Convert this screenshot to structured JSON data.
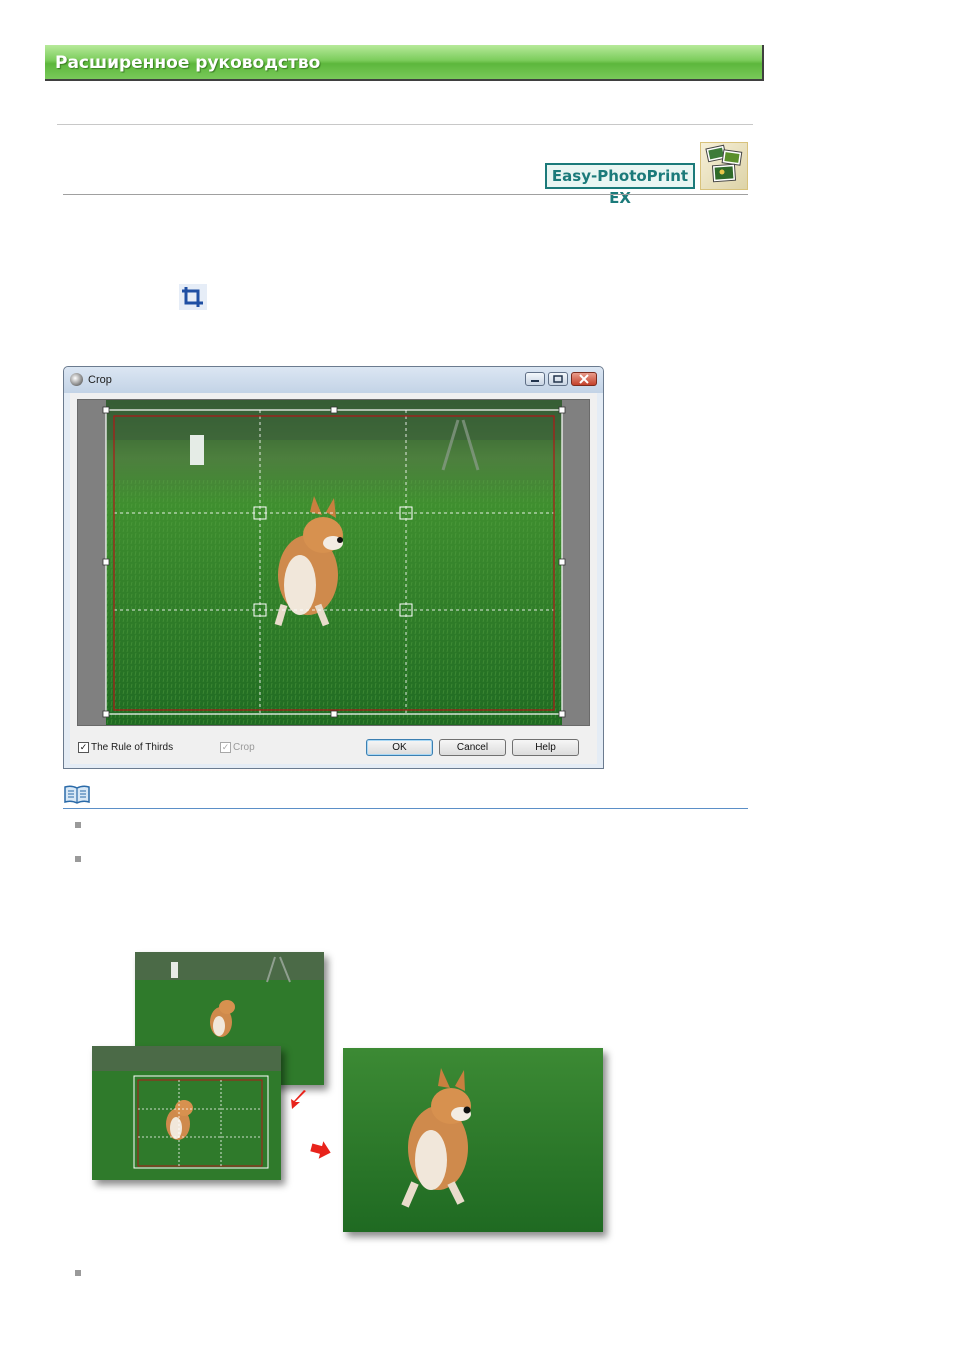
{
  "header": {
    "banner_title": "Расширенное руководство"
  },
  "product": {
    "name": "Easy-PhotoPrint EX",
    "icon": "product-photos-icon"
  },
  "toolbar": {
    "crop_icon": "crop-tool-icon"
  },
  "dialog": {
    "title": "Crop",
    "window_buttons": {
      "minimize": "minimize-button",
      "maximize": "maximize-button",
      "close": "close-button"
    },
    "rule_of_thirds": {
      "label": "The Rule of Thirds",
      "checked": true
    },
    "crop_option": {
      "label": "Crop",
      "checked": true,
      "enabled": false
    },
    "buttons": {
      "ok": "OK",
      "cancel": "Cancel",
      "help": "Help"
    }
  },
  "note": {
    "icon": "note-book-icon",
    "bullets": 3
  },
  "colors": {
    "banner_green": "#5db73c",
    "product_teal": "#1b7a7a",
    "crop_frame_red": "#b01818",
    "note_rule_blue": "#5b8fc7"
  }
}
